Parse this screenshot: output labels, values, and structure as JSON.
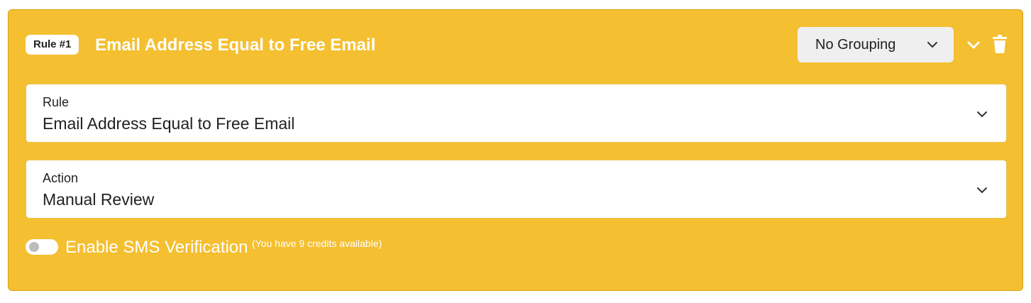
{
  "card": {
    "badge": "Rule #1",
    "title": "Email Address Equal to Free Email",
    "background_color": "#f4bf30"
  },
  "grouping": {
    "selected": "No Grouping",
    "icon": "chevron-down-icon"
  },
  "header_actions": {
    "collapse_icon": "chevron-down-icon",
    "delete_icon": "trash-icon"
  },
  "rule_field": {
    "label": "Rule",
    "value": "Email Address Equal to Free Email"
  },
  "action_field": {
    "label": "Action",
    "value": "Manual Review"
  },
  "sms": {
    "label": "Enable SMS Verification",
    "note": "(You have 9 credits available)",
    "enabled": false
  }
}
